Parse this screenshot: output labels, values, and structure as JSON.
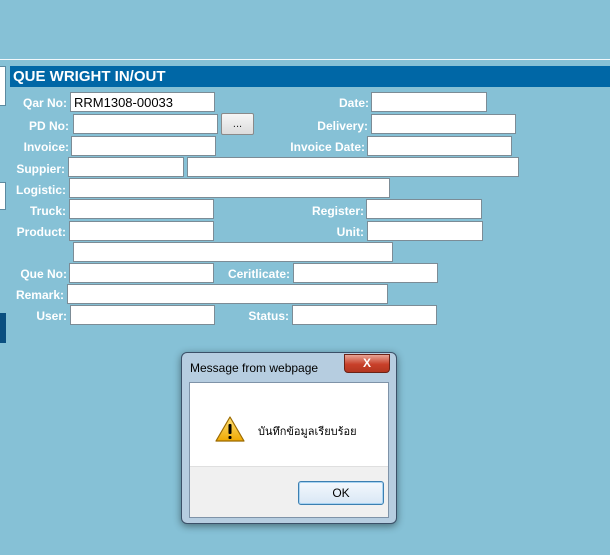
{
  "header": {
    "title": "QUE WRIGHT IN/OUT"
  },
  "form": {
    "labels": {
      "qar_no": "Qar No:",
      "date": "Date:",
      "pd_no": "PD No:",
      "delivery": "Delivery:",
      "invoice": "Invoice:",
      "invoice_date": "Invoice Date:",
      "supplier": "Suppier:",
      "logistic": "Logistic:",
      "truck": "Truck:",
      "register": "Register:",
      "product": "Product:",
      "unit": "Unit:",
      "que_no": "Que No:",
      "certificate": "Ceritlicate:",
      "remark": "Remark:",
      "user": "User:",
      "status": "Status:"
    },
    "values": {
      "qar_no": "RRM1308-00033",
      "date": "",
      "pd_no": "",
      "delivery": "",
      "invoice": "",
      "invoice_date": "",
      "supplier_code": "",
      "supplier_name": "",
      "logistic": "",
      "truck": "",
      "register": "",
      "product": "",
      "unit": "",
      "product_desc": "",
      "que_no": "",
      "certificate": "",
      "remark": "",
      "user": "",
      "status": ""
    },
    "browse_label": "..."
  },
  "dialog": {
    "title": "Message from webpage",
    "close_label": "X",
    "message": "บันทึกข้อมูลเรียบร้อย",
    "ok_label": "OK",
    "icon": "warning-icon"
  },
  "colors": {
    "background": "#86c1d6",
    "header": "#0067a6",
    "label": "#ffffff"
  }
}
